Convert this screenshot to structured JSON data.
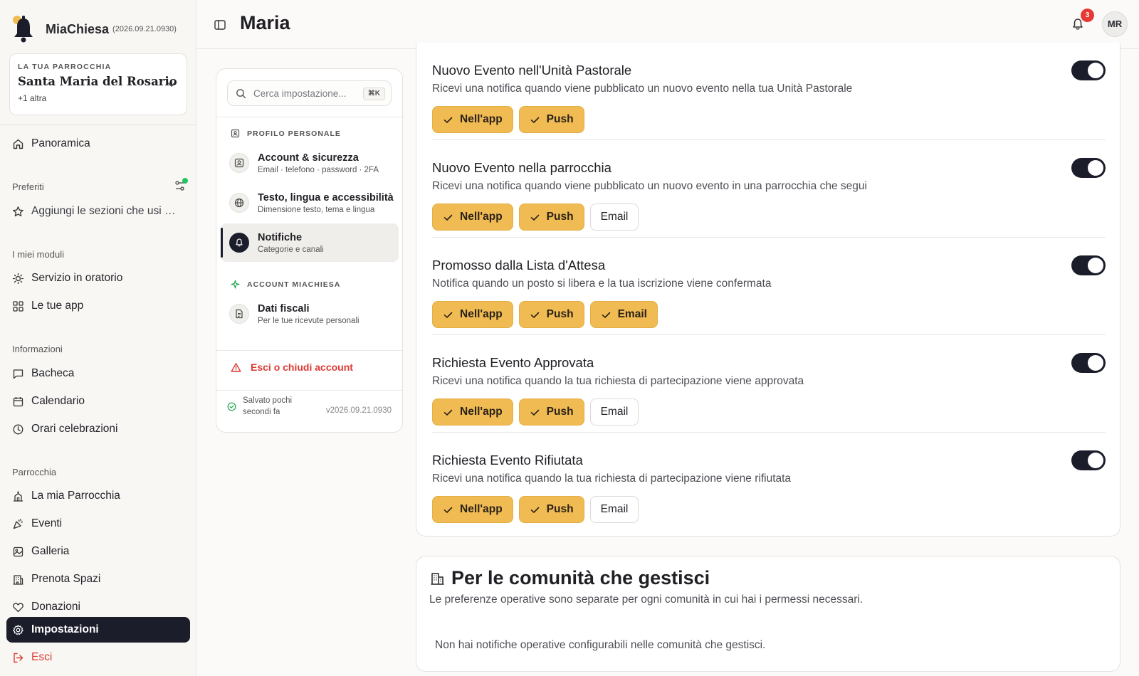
{
  "app": {
    "name": "MiaChiesa",
    "version": "(2026.09.21.0930)"
  },
  "parish": {
    "kicker": "LA TUA PARROCCHIA",
    "name": "Santa Maria del Rosario",
    "more": "+1 altra"
  },
  "sidebar": {
    "overview": "Panoramica",
    "favorites_label": "Preferiti",
    "favorites_hint": "Aggiungi le sezioni che usi più spesso",
    "modules_label": "I miei moduli",
    "modules": [
      "Servizio in oratorio",
      "Le tue app"
    ],
    "info_label": "Informazioni",
    "info": [
      "Bacheca",
      "Calendario",
      "Orari celebrazioni"
    ],
    "parish_label": "Parrocchia",
    "parish_items": [
      "La mia Parrocchia",
      "Eventi",
      "Galleria",
      "Prenota Spazi",
      "Donazioni"
    ],
    "settings": "Impostazioni",
    "logout": "Esci"
  },
  "header": {
    "title": "Maria",
    "notification_count": "3",
    "avatar_initials": "MR"
  },
  "settings_nav": {
    "search_placeholder": "Cerca impostazione...",
    "search_shortcut": "⌘K",
    "personal_section": "PROFILO PERSONALE",
    "items": [
      {
        "title": "Account & sicurezza",
        "sub": "Email · telefono · password · 2FA"
      },
      {
        "title": "Testo, lingua e accessibilità",
        "sub": "Dimensione testo, tema e lingua"
      },
      {
        "title": "Notifiche",
        "sub": "Categorie e canali"
      }
    ],
    "account_section": "ACCOUNT MIACHIESA",
    "fiscal": {
      "title": "Dati fiscali",
      "sub": "Per le tue ricevute personali"
    },
    "logout": "Esci o chiudi account",
    "saved": "Salvato pochi secondi fa",
    "version": "v2026.09.21.0930"
  },
  "notifications": [
    {
      "title": "Nuovo Evento nell'Unità Pastorale",
      "desc": "Ricevi una notifica quando viene pubblicato un nuovo evento nella tua Unità Pastorale",
      "enabled": true,
      "channels": {
        "inapp": true,
        "push": true
      }
    },
    {
      "title": "Nuovo Evento nella parrocchia",
      "desc": "Ricevi una notifica quando viene pubblicato un nuovo evento in una parrocchia che segui",
      "enabled": true,
      "channels": {
        "inapp": true,
        "push": true,
        "email": false
      }
    },
    {
      "title": "Promosso dalla Lista d'Attesa",
      "desc": "Notifica quando un posto si libera e la tua iscrizione viene confermata",
      "enabled": true,
      "channels": {
        "inapp": true,
        "push": true,
        "email": true
      }
    },
    {
      "title": "Richiesta Evento Approvata",
      "desc": "Ricevi una notifica quando la tua richiesta di partecipazione viene approvata",
      "enabled": true,
      "channels": {
        "inapp": true,
        "push": true,
        "email": false
      }
    },
    {
      "title": "Richiesta Evento Rifiutata",
      "desc": "Ricevi una notifica quando la tua richiesta di partecipazione viene rifiutata",
      "enabled": true,
      "channels": {
        "inapp": true,
        "push": true,
        "email": false
      }
    }
  ],
  "channel_labels": {
    "inapp": "Nell'app",
    "push": "Push",
    "email": "Email"
  },
  "community": {
    "title": "Per le comunità che gestisci",
    "desc": "Le preferenze operative sono separate per ogni comunità in cui hai i permessi necessari.",
    "empty": "Non hai notifiche operative configurabili nelle comunità che gestisci."
  },
  "colors": {
    "accent": "#f0bb52",
    "dark": "#1b1d2b",
    "danger": "#dc3b34",
    "online": "#22c55e"
  }
}
